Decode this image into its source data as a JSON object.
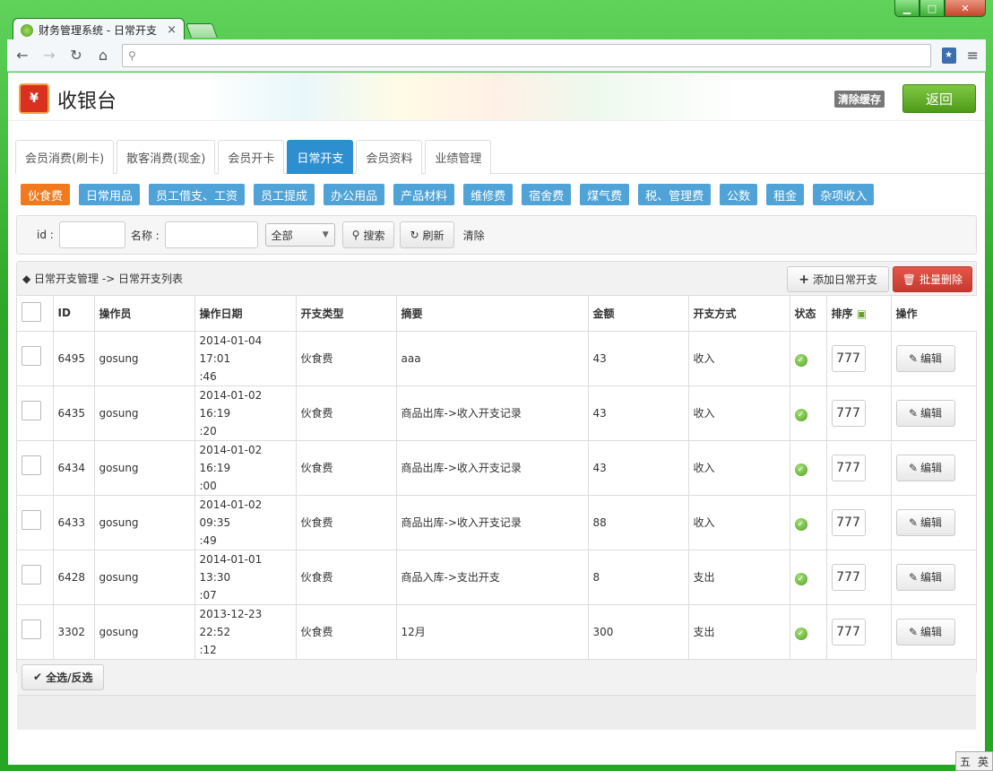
{
  "browser": {
    "tab_title": "财务管理系统 - 日常开支",
    "tab_close": "×",
    "win_min": "▁",
    "win_max": "□",
    "win_close": "✕",
    "url": ""
  },
  "header": {
    "title": "收银台",
    "clear_cache": "清除缓存",
    "back": "返回"
  },
  "main_tabs": [
    "会员消费(刷卡)",
    "散客消费(现金)",
    "会员开卡",
    "日常开支",
    "会员资料",
    "业绩管理"
  ],
  "active_main_tab": "日常开支",
  "categories": [
    "伙食费",
    "日常用品",
    "员工借支、工资",
    "员工提成",
    "办公用品",
    "产品材料",
    "维修费",
    "宿舍费",
    "煤气费",
    "税、管理费",
    "公数",
    "租金",
    "杂项收入"
  ],
  "active_category": "伙食费",
  "search": {
    "id_label": "id :",
    "name_label": "名称 :",
    "id_value": "",
    "name_value": "",
    "select_value": "全部",
    "search_btn": "搜索",
    "refresh_btn": "刷新",
    "clear": "清除"
  },
  "list": {
    "breadcrumb": "◆ 日常开支管理 -> 日常开支列表",
    "add_btn": "添加日常开支",
    "batch_delete": "批量删除",
    "columns": [
      "ID",
      "操作员",
      "操作日期",
      "开支类型",
      "摘要",
      "金额",
      "开支方式",
      "状态",
      "排序",
      "操作"
    ],
    "rows": [
      {
        "id": "6495",
        "operator": "gosung",
        "date": "2014-01-04 17:01",
        "time": ":46",
        "type": "伙食费",
        "summary": "aaa",
        "amount": "43",
        "method": "收入",
        "sort": "777",
        "edit": "编辑"
      },
      {
        "id": "6435",
        "operator": "gosung",
        "date": "2014-01-02 16:19",
        "time": ":20",
        "type": "伙食费",
        "summary": "商品出库->收入开支记录",
        "amount": "43",
        "method": "收入",
        "sort": "777",
        "edit": "编辑"
      },
      {
        "id": "6434",
        "operator": "gosung",
        "date": "2014-01-02 16:19",
        "time": ":00",
        "type": "伙食费",
        "summary": "商品出库->收入开支记录",
        "amount": "43",
        "method": "收入",
        "sort": "777",
        "edit": "编辑"
      },
      {
        "id": "6433",
        "operator": "gosung",
        "date": "2014-01-02 09:35",
        "time": ":49",
        "type": "伙食费",
        "summary": "商品出库->收入开支记录",
        "amount": "88",
        "method": "收入",
        "sort": "777",
        "edit": "编辑"
      },
      {
        "id": "6428",
        "operator": "gosung",
        "date": "2014-01-01 13:30",
        "time": ":07",
        "type": "伙食费",
        "summary": "商品入库->支出开支",
        "amount": "8",
        "method": "支出",
        "sort": "777",
        "edit": "编辑"
      },
      {
        "id": "3302",
        "operator": "gosung",
        "date": "2013-12-23 22:52",
        "time": ":12",
        "type": "伙食费",
        "summary": "12月",
        "amount": "300",
        "method": "支出",
        "sort": "777",
        "edit": "编辑"
      }
    ],
    "select_all": "全选/反选"
  },
  "ime": {
    "a": "五",
    "b": "英"
  }
}
